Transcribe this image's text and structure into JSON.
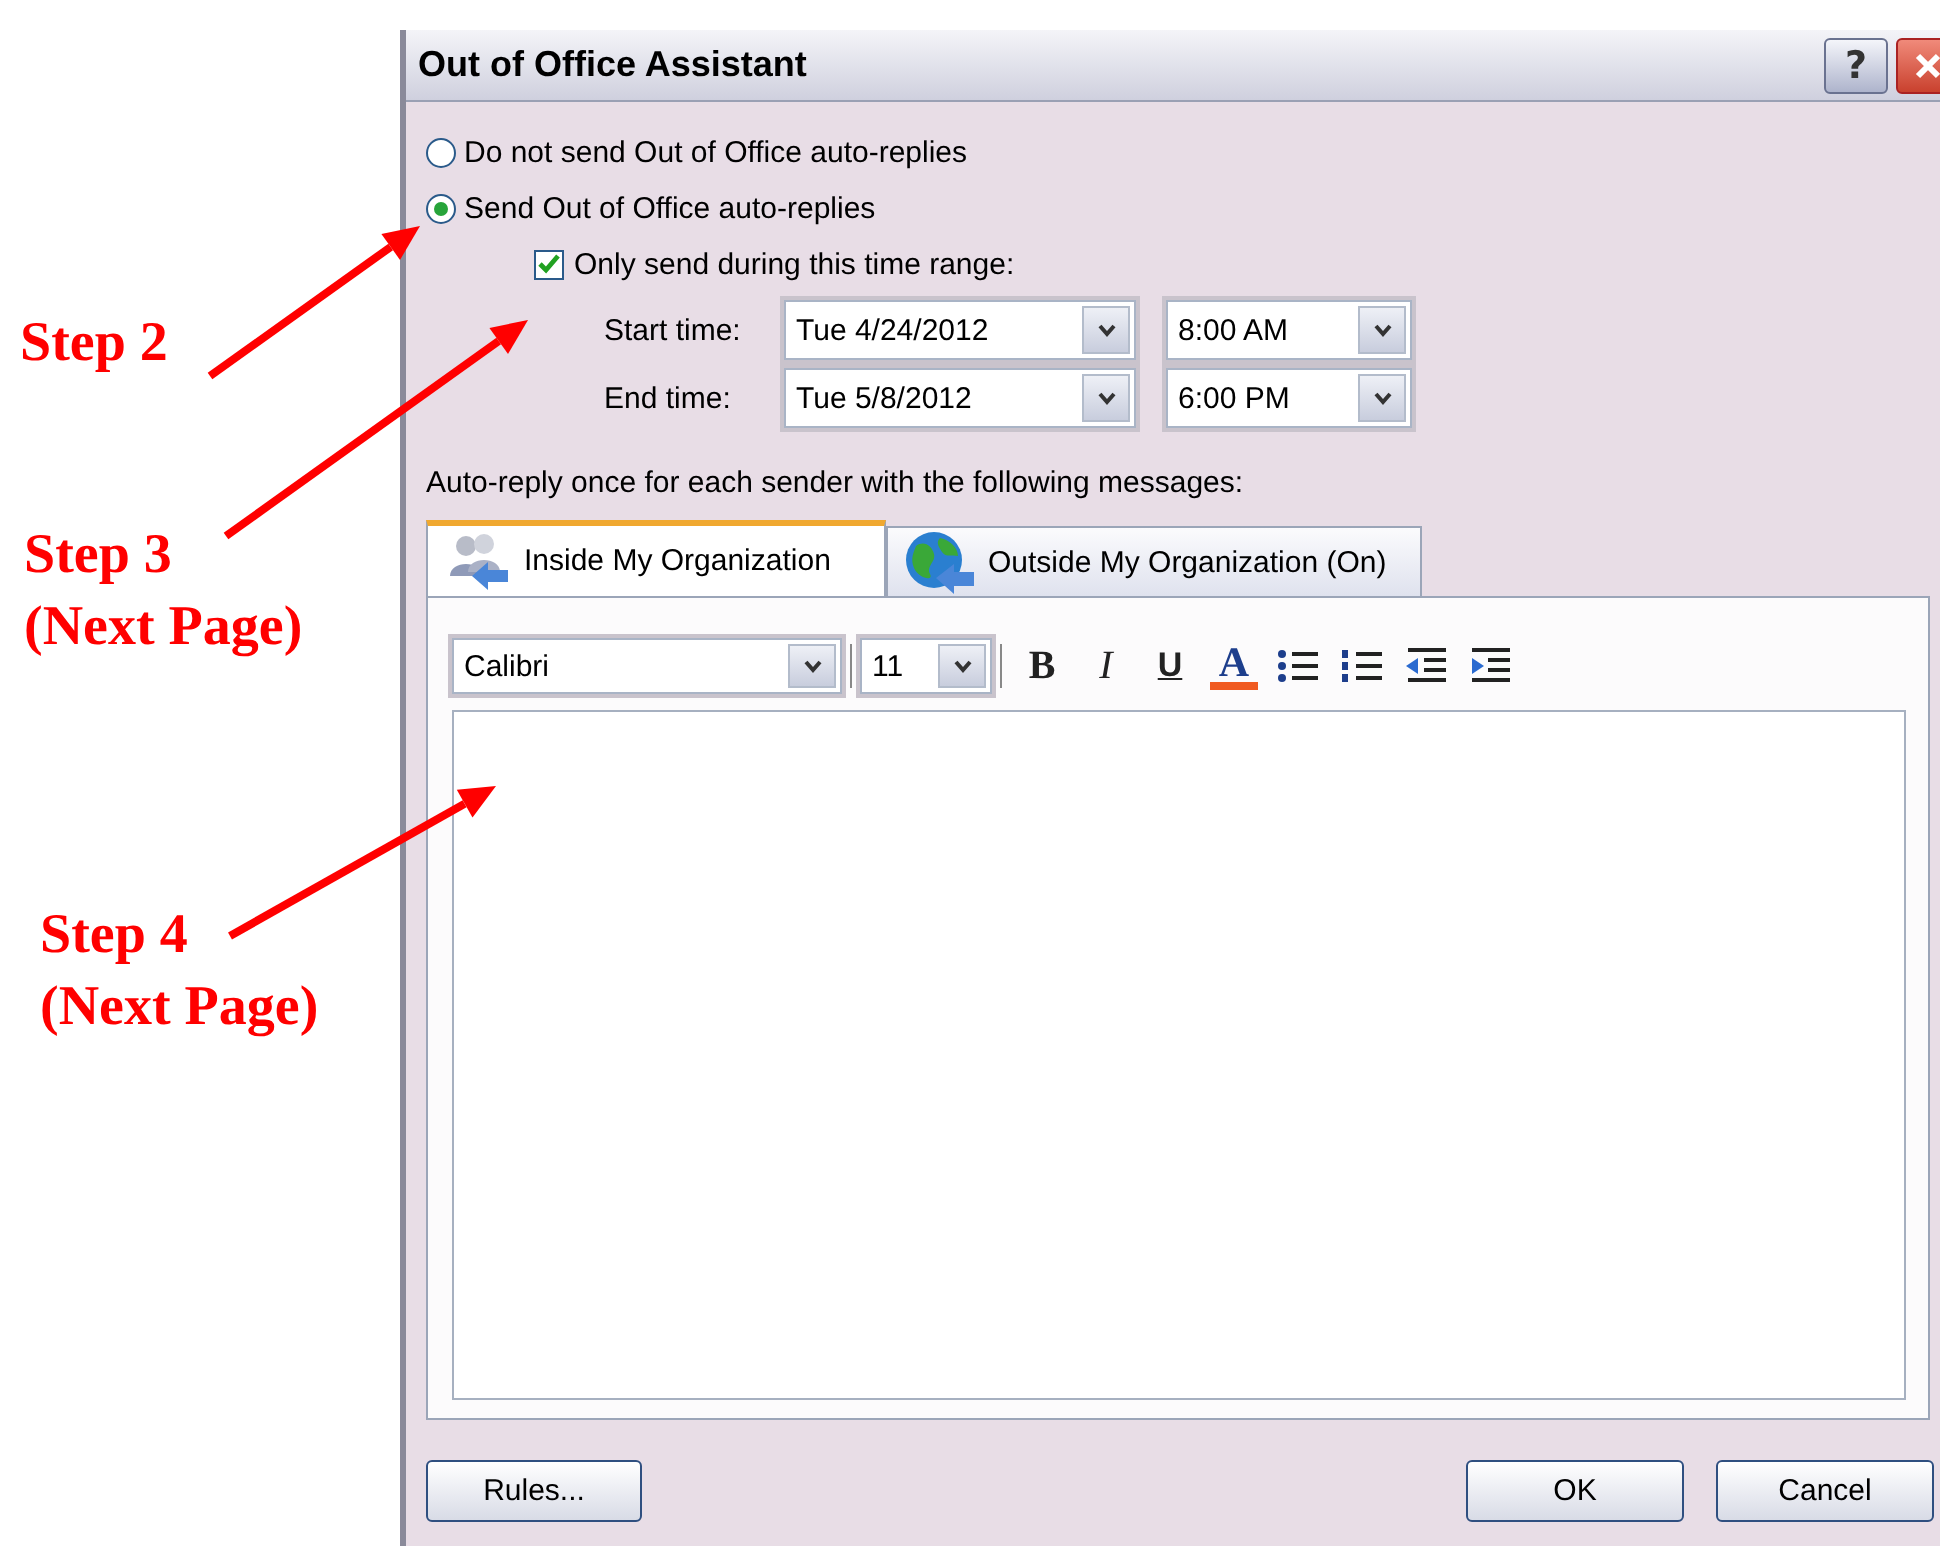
{
  "annotations": [
    {
      "lines": [
        "Step 2"
      ]
    },
    {
      "lines": [
        "Step 3",
        "(Next Page)"
      ]
    },
    {
      "lines": [
        "Step 4",
        "(Next Page)"
      ]
    }
  ],
  "window": {
    "title": "Out of Office Assistant",
    "help": "?"
  },
  "reply_mode": [
    {
      "label": "Do not send Out of Office auto-replies",
      "selected": false
    },
    {
      "label": "Send Out of Office auto-replies",
      "selected": true
    }
  ],
  "time_range": {
    "label": "Only send during this time range:",
    "checked": true,
    "rows": [
      {
        "label": "Start time:",
        "date": "Tue 4/24/2012",
        "time": "8:00 AM"
      },
      {
        "label": "End time:",
        "date": "Tue 5/8/2012",
        "time": "6:00 PM"
      }
    ]
  },
  "messages_label": "Auto-reply once for each sender with the following messages:",
  "tabs": [
    {
      "label": "Inside My Organization",
      "selected": true,
      "kind": "people"
    },
    {
      "label": "Outside My Organization (On)",
      "selected": false,
      "kind": "globe"
    }
  ],
  "toolbar": {
    "font": "Calibri",
    "size": "11",
    "buttons": [
      {
        "kind": "bold",
        "glyph": "B"
      },
      {
        "kind": "italic",
        "glyph": "I"
      },
      {
        "kind": "underline",
        "glyph": "U"
      },
      {
        "kind": "color",
        "glyph": "A"
      },
      {
        "kind": "bullets"
      },
      {
        "kind": "numbering"
      },
      {
        "kind": "outdent"
      },
      {
        "kind": "indent"
      }
    ]
  },
  "buttons": [
    {
      "label": "Rules...",
      "kind": "left"
    },
    {
      "label": "OK",
      "kind": "right"
    },
    {
      "label": "Cancel",
      "kind": "right"
    }
  ]
}
